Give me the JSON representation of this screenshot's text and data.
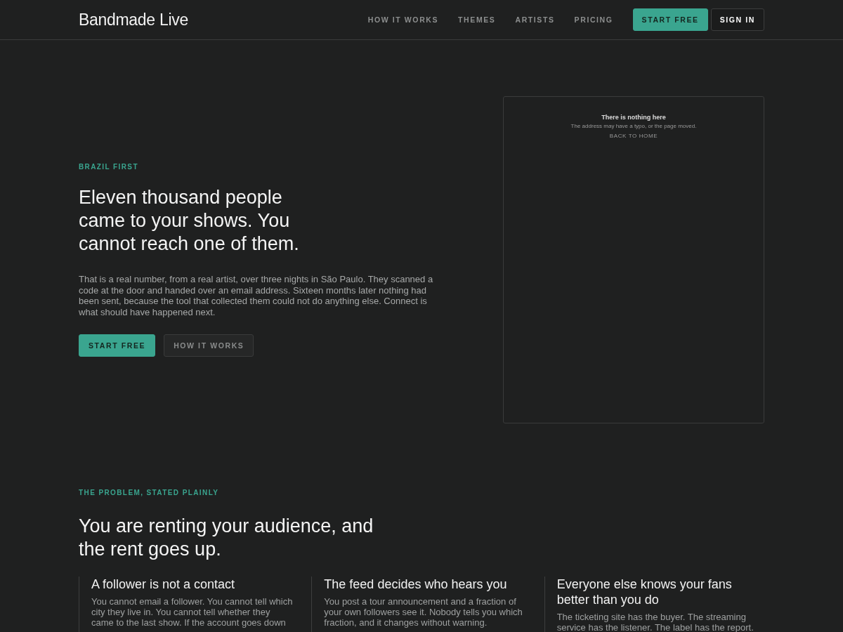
{
  "header": {
    "logo": "Bandmade Live",
    "nav": [
      "HOW IT WORKS",
      "THEMES",
      "ARTISTS",
      "PRICING"
    ],
    "primary_button": "START FREE",
    "secondary_button": "SIGN IN"
  },
  "hero": {
    "eyebrow": "BRAZIL FIRST",
    "headline": "Eleven thousand people came to your shows. You cannot reach one of them.",
    "body": "That is a real number, from a real artist, over three nights in São Paulo. They scanned a code at the door and handed over an email address. Sixteen months later nothing had been sent, because the tool that collected them could not do anything else. Connect is what should have happened next.",
    "primary_button": "START FREE",
    "secondary_button": "HOW IT WORKS",
    "preview": {
      "title": "There is nothing here",
      "text": "The address may have a typo, or the page moved.",
      "link": "BACK TO HOME"
    }
  },
  "problem": {
    "eyebrow": "THE PROBLEM, STATED PLAINLY",
    "headline": "You are renting your audience, and the rent goes up.",
    "cards": [
      {
        "title": "A follower is not a contact",
        "body": "You cannot email a follower. You cannot tell which city they live in. You cannot tell whether they came to the last show. If the account goes down"
      },
      {
        "title": "The feed decides who hears you",
        "body": "You post a tour announcement and a fraction of your own followers see it. Nobody tells you which fraction, and it changes without warning."
      },
      {
        "title": "Everyone else knows your fans better than you do",
        "body": "The ticketing site has the buyer. The streaming service has the listener. The label has the report."
      }
    ]
  }
}
